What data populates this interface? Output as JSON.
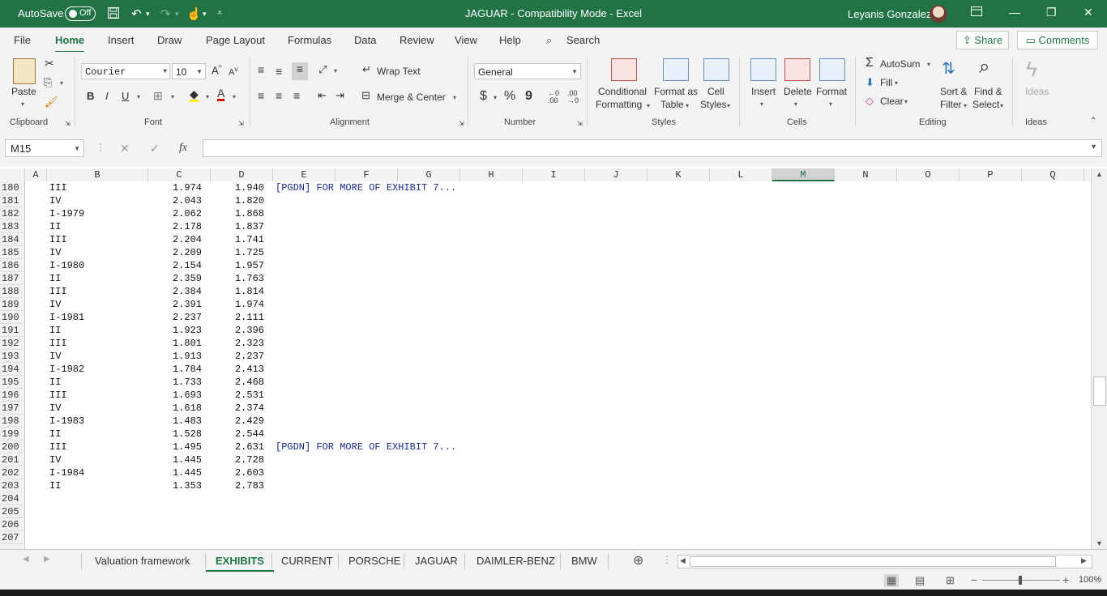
{
  "title_bar": {
    "autosave_label": "AutoSave",
    "autosave_state": "Off",
    "title": "JAGUAR  -  Compatibility Mode  -  Excel",
    "user_name": "Leyanis Gonzalez"
  },
  "ribbon_tabs": [
    "File",
    "Home",
    "Insert",
    "Draw",
    "Page Layout",
    "Formulas",
    "Data",
    "Review",
    "View",
    "Help"
  ],
  "active_ribbon_tab": "Home",
  "search_label": "Search",
  "share_label": "Share",
  "comments_label": "Comments",
  "ribbon": {
    "clipboard": {
      "paste": "Paste",
      "label": "Clipboard"
    },
    "font": {
      "name": "Courier",
      "size": "10",
      "label": "Font",
      "bold": "B",
      "italic": "I",
      "underline": "U"
    },
    "alignment": {
      "wrap_text": "Wrap Text",
      "merge_center": "Merge & Center",
      "label": "Alignment"
    },
    "number": {
      "format": "General",
      "label": "Number",
      "currency": "$",
      "percent": "%",
      "comma": "9"
    },
    "styles": {
      "conditional_1": "Conditional",
      "conditional_2": "Formatting",
      "format_table_1": "Format as",
      "format_table_2": "Table",
      "cell_styles_1": "Cell",
      "cell_styles_2": "Styles",
      "label": "Styles"
    },
    "cells": {
      "insert": "Insert",
      "delete": "Delete",
      "format": "Format",
      "label": "Cells"
    },
    "editing": {
      "autosum": "AutoSum",
      "fill": "Fill",
      "clear": "Clear",
      "sort_1": "Sort &",
      "sort_2": "Filter",
      "find_1": "Find &",
      "find_2": "Select",
      "label": "Editing"
    },
    "ideas": {
      "ideas_button": "Ideas",
      "label": "Ideas"
    }
  },
  "name_box": "M15",
  "formula": "",
  "columns": [
    "A",
    "B",
    "C",
    "D",
    "E",
    "F",
    "G",
    "H",
    "I",
    "J",
    "K",
    "L",
    "M",
    "N",
    "O",
    "P",
    "Q"
  ],
  "selected_column": "M",
  "rows": [
    {
      "n": "180",
      "b": "III",
      "c": "1.974",
      "d": "1.940",
      "e": "[PGDN] FOR MORE OF EXHIBIT 7..."
    },
    {
      "n": "181",
      "b": "IV",
      "c": "2.043",
      "d": "1.820",
      "e": ""
    },
    {
      "n": "182",
      "b": "I-1979",
      "c": "2.062",
      "d": "1.868",
      "e": ""
    },
    {
      "n": "183",
      "b": "II",
      "c": "2.178",
      "d": "1.837",
      "e": ""
    },
    {
      "n": "184",
      "b": "III",
      "c": "2.204",
      "d": "1.741",
      "e": ""
    },
    {
      "n": "185",
      "b": "IV",
      "c": "2.209",
      "d": "1.725",
      "e": ""
    },
    {
      "n": "186",
      "b": "I-1980",
      "c": "2.154",
      "d": "1.957",
      "e": ""
    },
    {
      "n": "187",
      "b": "II",
      "c": "2.359",
      "d": "1.763",
      "e": ""
    },
    {
      "n": "188",
      "b": "III",
      "c": "2.384",
      "d": "1.814",
      "e": ""
    },
    {
      "n": "189",
      "b": "IV",
      "c": "2.391",
      "d": "1.974",
      "e": ""
    },
    {
      "n": "190",
      "b": "I-1981",
      "c": "2.237",
      "d": "2.111",
      "e": ""
    },
    {
      "n": "191",
      "b": "II",
      "c": "1.923",
      "d": "2.396",
      "e": ""
    },
    {
      "n": "192",
      "b": "III",
      "c": "1.801",
      "d": "2.323",
      "e": ""
    },
    {
      "n": "193",
      "b": "IV",
      "c": "1.913",
      "d": "2.237",
      "e": ""
    },
    {
      "n": "194",
      "b": "I-1982",
      "c": "1.784",
      "d": "2.413",
      "e": ""
    },
    {
      "n": "195",
      "b": "II",
      "c": "1.733",
      "d": "2.468",
      "e": ""
    },
    {
      "n": "196",
      "b": "III",
      "c": "1.693",
      "d": "2.531",
      "e": ""
    },
    {
      "n": "197",
      "b": "IV",
      "c": "1.618",
      "d": "2.374",
      "e": ""
    },
    {
      "n": "198",
      "b": "I-1983",
      "c": "1.483",
      "d": "2.429",
      "e": ""
    },
    {
      "n": "199",
      "b": "II",
      "c": "1.528",
      "d": "2.544",
      "e": ""
    },
    {
      "n": "200",
      "b": "III",
      "c": "1.495",
      "d": "2.631",
      "e": "[PGDN] FOR MORE OF EXHIBIT 7..."
    },
    {
      "n": "201",
      "b": "IV",
      "c": "1.445",
      "d": "2.728",
      "e": ""
    },
    {
      "n": "202",
      "b": "I-1984",
      "c": "1.445",
      "d": "2.603",
      "e": ""
    },
    {
      "n": "203",
      "b": "II",
      "c": "1.353",
      "d": "2.783",
      "e": ""
    },
    {
      "n": "204",
      "b": "",
      "c": "",
      "d": "",
      "e": ""
    },
    {
      "n": "205",
      "b": "",
      "c": "",
      "d": "",
      "e": ""
    },
    {
      "n": "206",
      "b": "",
      "c": "",
      "d": "",
      "e": ""
    },
    {
      "n": "207",
      "b": "",
      "c": "",
      "d": "",
      "e": ""
    }
  ],
  "sheet_tabs": [
    "Valuation framework",
    "EXHIBITS",
    "CURRENT",
    "PORSCHE",
    "JAGUAR",
    "DAIMLER-BENZ",
    "BMW"
  ],
  "active_sheet": "EXHIBITS",
  "zoom": "100%",
  "colors": {
    "excel_green": "#217346",
    "note_text": "#1b2b8f"
  }
}
